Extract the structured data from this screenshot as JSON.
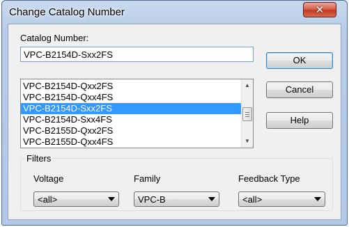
{
  "window": {
    "title": "Change Catalog Number"
  },
  "catalog": {
    "label": "Catalog Number:",
    "value": "VPC-B2154D-Sxx2FS"
  },
  "list": {
    "items": [
      "VPC-B2154D-Qxx2FS",
      "VPC-B2154D-Qxx4FS",
      "VPC-B2154D-Sxx2FS",
      "VPC-B2154D-Sxx4FS",
      "VPC-B2155D-Qxx2FS",
      "VPC-B2155D-Qxx4FS"
    ],
    "selected_index": 2
  },
  "buttons": {
    "ok": "OK",
    "cancel": "Cancel",
    "help": "Help"
  },
  "filters": {
    "title": "Filters",
    "voltage": {
      "label": "Voltage",
      "value": "<all>"
    },
    "family": {
      "label": "Family",
      "value": "VPC-B"
    },
    "feedback": {
      "label": "Feedback Type",
      "value": "<all>"
    }
  },
  "icons": {
    "close": "close-icon",
    "scroll_up": "scroll-up-icon",
    "scroll_down": "scroll-down-icon",
    "dropdown": "chevron-down-icon"
  }
}
